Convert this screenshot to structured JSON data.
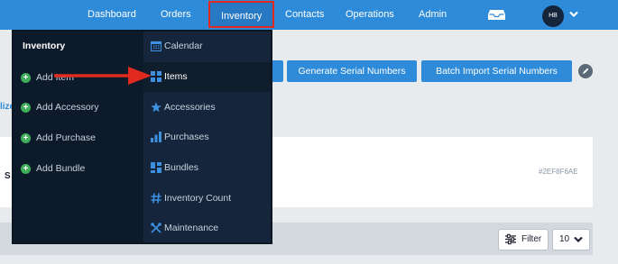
{
  "nav": {
    "items": [
      {
        "label": "Dashboard"
      },
      {
        "label": "Orders"
      },
      {
        "label": "Inventory"
      },
      {
        "label": "Contacts"
      },
      {
        "label": "Operations"
      },
      {
        "label": "Admin"
      }
    ],
    "avatar_initials": "HB"
  },
  "toolbar": {
    "generate_label": "Generate Serial Numbers",
    "batch_import_label": "Batch Import Serial Numbers"
  },
  "page": {
    "side_partial": "lize",
    "card_letter": "S",
    "record_hash": "#2EF8F6AE",
    "filter_label": "Filter",
    "page_size": "10"
  },
  "dropdown": {
    "title": "Inventory",
    "left_items": [
      {
        "label": "Add Item"
      },
      {
        "label": "Add Accessory"
      },
      {
        "label": "Add Purchase"
      },
      {
        "label": "Add Bundle"
      }
    ],
    "right_items": [
      {
        "label": "Calendar",
        "icon": "calendar-icon"
      },
      {
        "label": "Items",
        "icon": "grid-icon"
      },
      {
        "label": "Accessories",
        "icon": "star-icon"
      },
      {
        "label": "Purchases",
        "icon": "bar-chart-icon"
      },
      {
        "label": "Bundles",
        "icon": "bundle-icon"
      },
      {
        "label": "Inventory Count",
        "icon": "hash-icon"
      },
      {
        "label": "Maintenance",
        "icon": "tools-icon"
      }
    ]
  },
  "colors": {
    "nav_bg": "#2e8bd9",
    "dropdown_bg": "#15253b",
    "highlight_red": "#e02a1f",
    "plus_green": "#3fae5a",
    "icon_blue": "#3d8fe0"
  }
}
